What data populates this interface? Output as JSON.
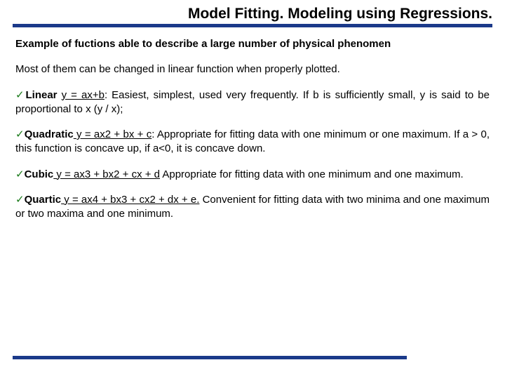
{
  "title": "Model Fitting. Modeling using Regressions.",
  "subhead": "Example of fuctions able to describe a large number of physical phenomen",
  "intro": "Most of them can be changed in linear function when properly plotted.",
  "items": {
    "linear": {
      "name": "Linear",
      "formula": "y = ax+b",
      "desc": ": Easiest, simplest, used very frequently. If b is sufficiently small, y is said to be proportional to x (y / x);"
    },
    "quadratic": {
      "name": "Quadratic",
      "formula": " y = ax2 + bx + c",
      "desc": ": Appropriate for fitting data with one minimum or one maximum. If a > 0, this function is concave up, if a<0, it is concave down."
    },
    "cubic": {
      "name": "Cubic",
      "formula": " y = ax3 + bx2 + cx + d",
      "desc": " Appropriate for fitting data with one minimum and one maximum."
    },
    "quartic": {
      "name": "Quartic",
      "formula": " y = ax4 + bx3 + cx2 + dx + e.",
      "desc": "  Convenient for fitting data with two minima and one maximum or two maxima and one minimum."
    }
  }
}
